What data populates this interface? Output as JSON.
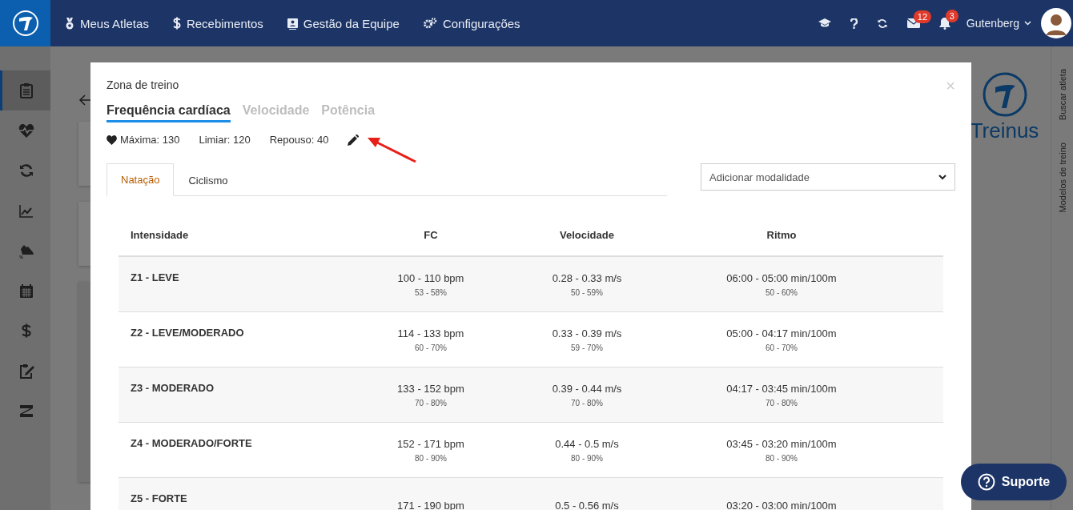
{
  "nav": {
    "items": [
      {
        "label": "Meus Atletas"
      },
      {
        "label": "Recebimentos"
      },
      {
        "label": "Gestão da Equipe"
      },
      {
        "label": "Configurações"
      }
    ],
    "messages_badge": "12",
    "notifications_badge": "3",
    "user": "Gutenberg"
  },
  "sidebar": {
    "items": [
      {
        "selected": true
      },
      {
        "selected": false
      },
      {
        "selected": false
      },
      {
        "selected": false
      },
      {
        "selected": false
      },
      {
        "selected": false
      },
      {
        "selected": false
      },
      {
        "selected": false
      },
      {
        "selected": false
      }
    ]
  },
  "right_panel": {
    "logo_text": "Treinus",
    "links": [
      "Buscar atleta",
      "Modelos de treino"
    ]
  },
  "modal": {
    "title": "Zona de treino",
    "close": "×",
    "tabs": [
      {
        "label": "Frequência cardíaca",
        "selected": true
      },
      {
        "label": "Velocidade",
        "selected": false
      },
      {
        "label": "Potência",
        "selected": false
      }
    ],
    "stats": [
      "Máxima: 130",
      "Limiar: 120",
      "Repouso: 40"
    ],
    "sport_tabs": [
      {
        "label": "Natação",
        "selected": true
      },
      {
        "label": "Ciclismo",
        "selected": false
      }
    ],
    "add_sport": {
      "value": "Adicionar modalidade"
    },
    "table": {
      "columns": [
        "Intensidade",
        "FC",
        "Velocidade",
        "Ritmo"
      ],
      "rows": [
        {
          "zone": "Z1 - LEVE",
          "fc": "100 - 110 bpm",
          "fc_pct": "53 - 58%",
          "speed": "0.28 - 0.33 m/s",
          "speed_pct": "50 - 59%",
          "pace": "06:00 - 05:00 min/100m",
          "pace_pct": "50 - 60%"
        },
        {
          "zone": "Z2 - LEVE/MODERADO",
          "fc": "114 - 133 bpm",
          "fc_pct": "60 - 70%",
          "speed": "0.33 - 0.39 m/s",
          "speed_pct": "59 - 70%",
          "pace": "05:00 - 04:17 min/100m",
          "pace_pct": "60 - 70%"
        },
        {
          "zone": "Z3 - MODERADO",
          "fc": "133 - 152 bpm",
          "fc_pct": "70 - 80%",
          "speed": "0.39 - 0.44 m/s",
          "speed_pct": "70 - 80%",
          "pace": "04:17 - 03:45 min/100m",
          "pace_pct": "70 - 80%"
        },
        {
          "zone": "Z4 - MODERADO/FORTE",
          "fc": "152 - 171 bpm",
          "fc_pct": "80 - 90%",
          "speed": "0.44 - 0.5 m/s",
          "speed_pct": "80 - 90%",
          "pace": "03:45 - 03:20 min/100m",
          "pace_pct": "80 - 90%"
        },
        {
          "zone": "Z5 - FORTE",
          "fc": "171 - 190 bpm",
          "speed": "0.5 - 0.56 m/s",
          "pace": "03:20 - 03:00 min/100m"
        }
      ]
    }
  },
  "support_button": "Suporte"
}
